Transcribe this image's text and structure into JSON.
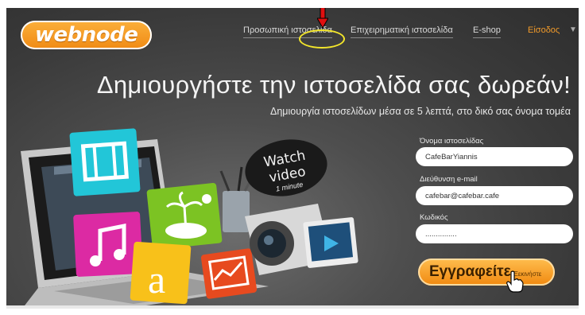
{
  "brand": {
    "logo_text": "webnode"
  },
  "nav": {
    "personal": "Προσωπική ιστοσελίδα",
    "business": "Επιχειρηματική ιστοσελίδα",
    "eshop": "E-shop",
    "login": "Είσοδος"
  },
  "hero": {
    "headline": "Δημιουργήστε την ιστοσελίδα σας δωρεάν!",
    "subhead": "Δημιουργία ιστοσελίδων μέσα σε 5 λεπτά, στο δικό σας όνομα τομέα",
    "video_title": "Watch video",
    "video_duration": "1 minute"
  },
  "form": {
    "site_name_label": "Όνομα ιστοσελίδας",
    "site_name_value": "CafeBarYiannis",
    "email_label": "Διεύθυνση e-mail",
    "email_value": "cafebar@cafebar.cafe",
    "password_label": "Κωδικός",
    "password_value": "...............",
    "register_label": "Εγγραφείτε",
    "register_sub": "Ξεκινήστε"
  },
  "colors": {
    "accent_orange": "#f0880f",
    "annotation_red": "#e01010",
    "annotation_yellow": "#f3e62b"
  }
}
